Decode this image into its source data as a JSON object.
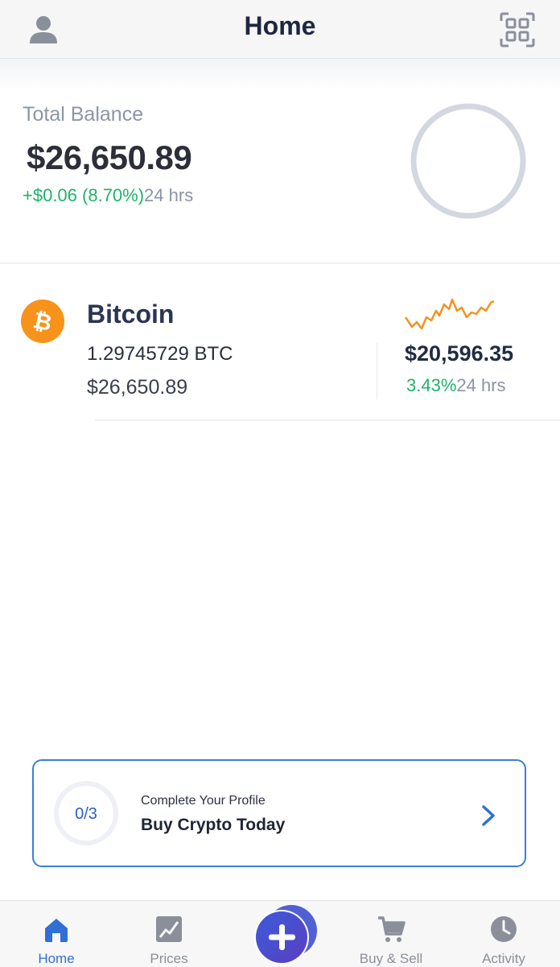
{
  "header": {
    "title": "Home",
    "left_icon": "profile-icon",
    "right_icon": "qr-code-icon"
  },
  "balance": {
    "label": "Total Balance",
    "amount": "$26,650.89",
    "change": "+$0.06 (8.70%)",
    "period": "24 hrs"
  },
  "assets": [
    {
      "name": "Bitcoin",
      "icon": "bitcoin-icon",
      "amount": "1.29745729 BTC",
      "value": "$26,650.89",
      "price": "$20,596.35",
      "change": "3.43%",
      "period": "24 hrs",
      "sparkline_color": "#f2931f"
    }
  ],
  "profile_card": {
    "progress": "0/3",
    "progress_fraction": 0,
    "subtitle": "Complete Your Profile",
    "title": "Buy Crypto Today"
  },
  "nav": {
    "items": [
      {
        "label": "Home",
        "icon": "home-icon",
        "active": true
      },
      {
        "label": "Prices",
        "icon": "chart-icon",
        "active": false
      },
      {
        "label": "Buy & Sell",
        "icon": "cart-icon",
        "active": false
      },
      {
        "label": "Activity",
        "icon": "clock-icon",
        "active": false
      }
    ],
    "center_action_icon": "plus-icon"
  },
  "colors": {
    "accent": "#2f6fd6",
    "positive": "#1fb36a",
    "bitcoin": "#f7931a",
    "card_border": "#3b7ddd"
  }
}
